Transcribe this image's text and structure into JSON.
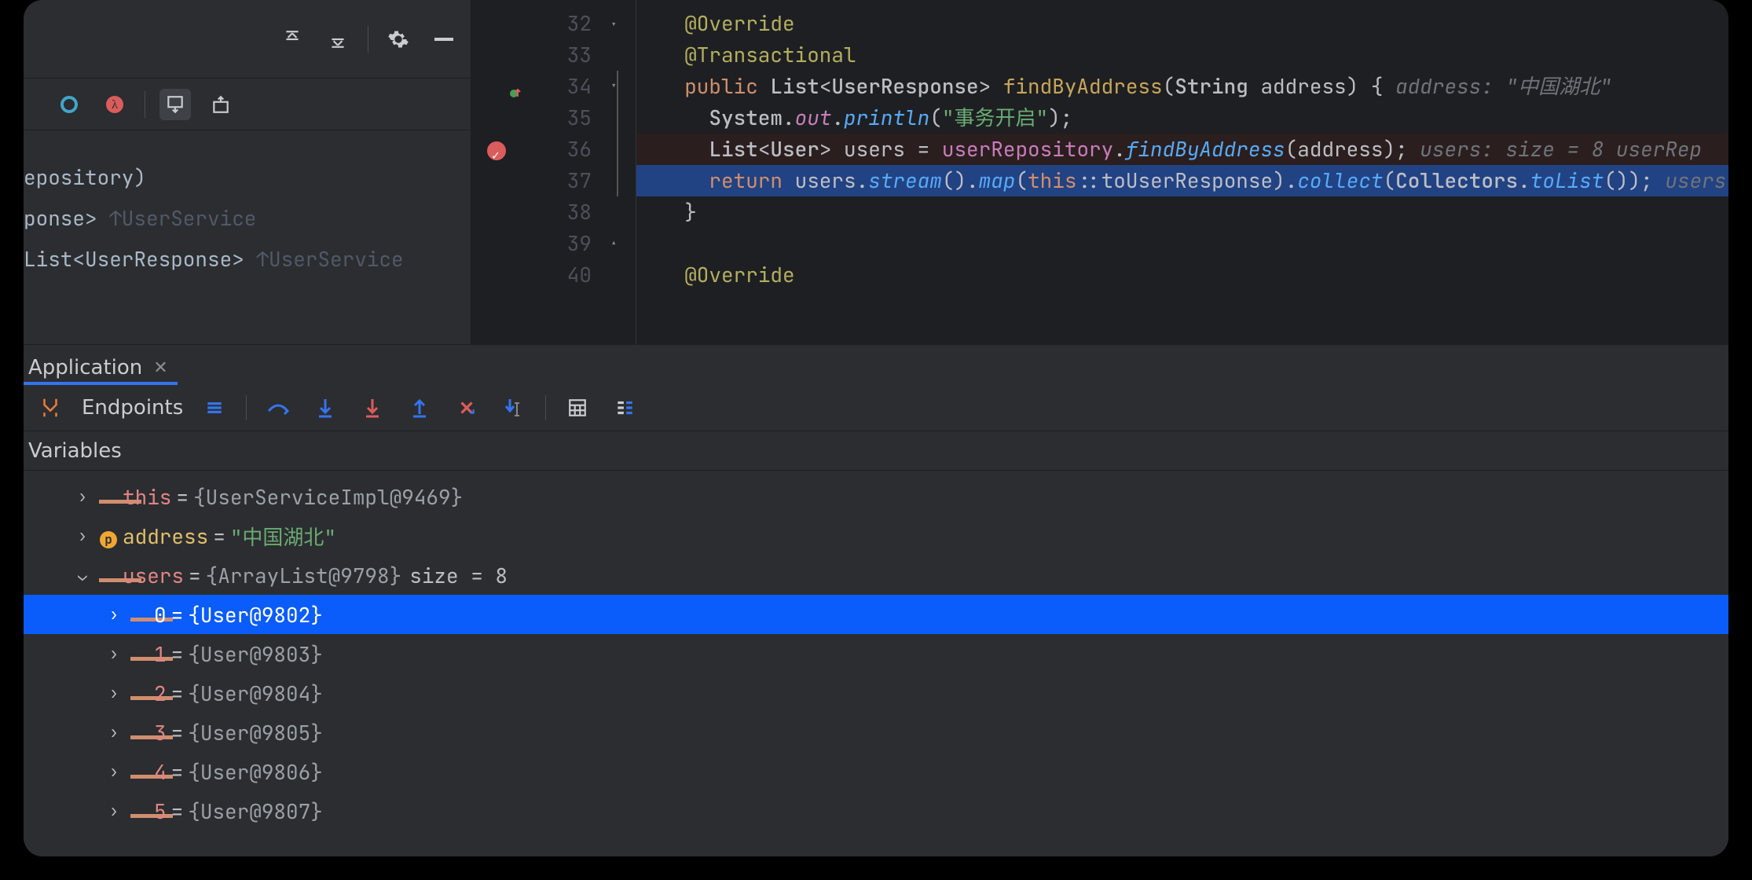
{
  "left_panel": {
    "structure_items": [
      {
        "text": "epository)"
      },
      {
        "text": "ponse> ",
        "ref": "↑UserService"
      },
      {
        "text": "List<UserResponse> ",
        "ref": "↑UserService"
      }
    ]
  },
  "editor": {
    "lines": [
      {
        "num": 32,
        "tokens": [
          {
            "cls": "ann",
            "t": "@Override"
          }
        ],
        "indent": 1
      },
      {
        "num": 33,
        "tokens": [
          {
            "cls": "ann",
            "t": "@Transactional"
          }
        ],
        "indent": 1
      },
      {
        "num": 34,
        "modified": true,
        "tokens": [
          {
            "cls": "kw",
            "t": "public "
          },
          {
            "cls": "type",
            "t": "List"
          },
          {
            "cls": "punc",
            "t": "<"
          },
          {
            "cls": "type",
            "t": "UserResponse"
          },
          {
            "cls": "punc",
            "t": "> "
          },
          {
            "cls": "fn",
            "t": "findByAddress"
          },
          {
            "cls": "paren",
            "t": "("
          },
          {
            "cls": "type",
            "t": "String "
          },
          {
            "cls": "var",
            "t": "address"
          },
          {
            "cls": "paren",
            "t": ") "
          },
          {
            "cls": "punc",
            "t": "{   "
          },
          {
            "cls": "hint",
            "t": "address: \"中国湖北\""
          }
        ],
        "indent": 1
      },
      {
        "num": 35,
        "tokens": [
          {
            "cls": "type",
            "t": "System"
          },
          {
            "cls": "punc",
            "t": "."
          },
          {
            "cls": "field-i",
            "t": "out"
          },
          {
            "cls": "punc",
            "t": "."
          },
          {
            "cls": "call",
            "t": "println"
          },
          {
            "cls": "paren",
            "t": "("
          },
          {
            "cls": "str",
            "t": "\"事务开启\""
          },
          {
            "cls": "paren",
            "t": ")"
          },
          {
            "cls": "punc",
            "t": ";"
          }
        ],
        "indent": 2
      },
      {
        "num": 36,
        "breakpoint": true,
        "dim": true,
        "tokens": [
          {
            "cls": "type",
            "t": "List"
          },
          {
            "cls": "punc",
            "t": "<"
          },
          {
            "cls": "type",
            "t": "User"
          },
          {
            "cls": "punc",
            "t": "> "
          },
          {
            "cls": "var",
            "t": "users "
          },
          {
            "cls": "op",
            "t": "= "
          },
          {
            "cls": "field",
            "t": "userRepository"
          },
          {
            "cls": "punc",
            "t": "."
          },
          {
            "cls": "call",
            "t": "findByAddress"
          },
          {
            "cls": "paren",
            "t": "("
          },
          {
            "cls": "var",
            "t": "address"
          },
          {
            "cls": "paren",
            "t": ")"
          },
          {
            "cls": "punc",
            "t": ";   "
          },
          {
            "cls": "hint",
            "t": "users:  size = 8  userRep"
          }
        ],
        "indent": 2
      },
      {
        "num": 37,
        "exec": true,
        "tokens": [
          {
            "cls": "kw",
            "t": "return "
          },
          {
            "cls": "var",
            "t": "users"
          },
          {
            "cls": "punc",
            "t": "."
          },
          {
            "cls": "call",
            "t": "stream"
          },
          {
            "cls": "paren",
            "t": "()"
          },
          {
            "cls": "punc",
            "t": "."
          },
          {
            "cls": "call",
            "t": "map"
          },
          {
            "cls": "paren",
            "t": "("
          },
          {
            "cls": "kw",
            "t": "this"
          },
          {
            "cls": "punc",
            "t": "::"
          },
          {
            "cls": "var",
            "t": "toUserResponse"
          },
          {
            "cls": "paren",
            "t": ")"
          },
          {
            "cls": "punc",
            "t": "."
          },
          {
            "cls": "call",
            "t": "collect"
          },
          {
            "cls": "paren",
            "t": "("
          },
          {
            "cls": "type",
            "t": "Collectors"
          },
          {
            "cls": "punc",
            "t": "."
          },
          {
            "cls": "call",
            "t": "toList"
          },
          {
            "cls": "paren",
            "t": "())"
          },
          {
            "cls": "punc",
            "t": ";   "
          },
          {
            "cls": "hint",
            "t": "users"
          }
        ],
        "indent": 2
      },
      {
        "num": 38,
        "tokens": [
          {
            "cls": "punc",
            "t": "}"
          }
        ],
        "indent": 1
      },
      {
        "num": 39,
        "tokens": [],
        "indent": 0
      },
      {
        "num": 40,
        "tokens": [
          {
            "cls": "ann",
            "t": "@Override"
          }
        ],
        "indent": 1
      }
    ]
  },
  "debug": {
    "tab_label": "Application",
    "endpoints_label": "Endpoints",
    "vars_header": "Variables",
    "variables": [
      {
        "level": 1,
        "chev": "right",
        "icon": "obj",
        "name": "this",
        "eq": " = ",
        "obj": "{UserServiceImpl@9469}"
      },
      {
        "level": 1,
        "chev": "right",
        "icon": "param",
        "name": "address",
        "nameCls": "param",
        "eq": " = ",
        "str": "\"中国湖北\""
      },
      {
        "level": 1,
        "chev": "down",
        "icon": "obj",
        "name": "users",
        "eq": " = ",
        "obj": "{ArrayList@9798}",
        "tail": " size = 8"
      },
      {
        "level": 2,
        "chev": "right",
        "icon": "obj",
        "name": "0",
        "eq": " = ",
        "obj": "{User@9802}",
        "selected": true
      },
      {
        "level": 2,
        "chev": "right",
        "icon": "obj",
        "name": "1",
        "eq": " = ",
        "obj": "{User@9803}"
      },
      {
        "level": 2,
        "chev": "right",
        "icon": "obj",
        "name": "2",
        "eq": " = ",
        "obj": "{User@9804}"
      },
      {
        "level": 2,
        "chev": "right",
        "icon": "obj",
        "name": "3",
        "eq": " = ",
        "obj": "{User@9805}"
      },
      {
        "level": 2,
        "chev": "right",
        "icon": "obj",
        "name": "4",
        "eq": " = ",
        "obj": "{User@9806}"
      },
      {
        "level": 2,
        "chev": "right",
        "icon": "obj",
        "name": "5",
        "eq": " = ",
        "obj": "{User@9807}"
      }
    ]
  }
}
